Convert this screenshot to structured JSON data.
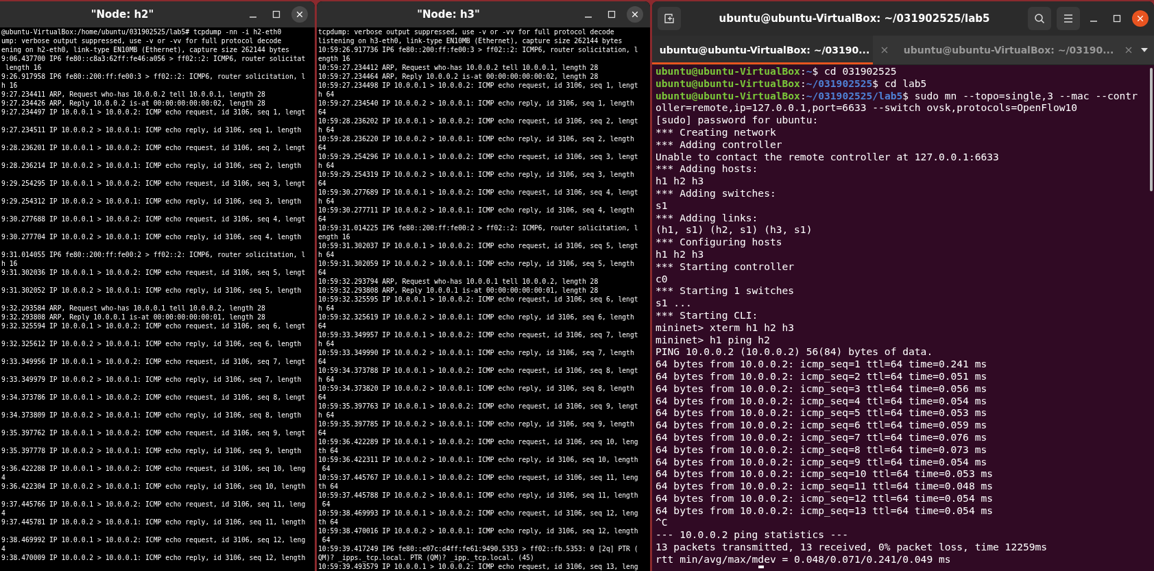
{
  "windows": [
    {
      "kind": "xterm",
      "title": "\"Node: h2\"",
      "lines": [
        {
          "kind": "text",
          "text": "@ubuntu-VirtualBox:/home/ubuntu/031902525/lab5# tcpdump -nn -i h2-eth0"
        },
        {
          "kind": "text",
          "text": "ump: verbose output suppressed, use -v or -vv for full protocol decode"
        },
        {
          "kind": "text",
          "text": "ening on h2-eth0, link-type EN10MB (Ethernet), capture size 262144 bytes"
        },
        {
          "kind": "text",
          "text": "9:06.437700 IP6 fe80::c8a3:62ff:fe46:a056 > ff02::2: ICMP6, router solicitat"
        },
        {
          "kind": "text",
          "text": " length 16"
        },
        {
          "kind": "text",
          "text": "9:26.917958 IP6 fe80::200:ff:fe00:3 > ff02::2: ICMP6, router solicitation, l"
        },
        {
          "kind": "text",
          "text": "h 16"
        },
        {
          "kind": "text",
          "text": "9:27.234411 ARP, Request who-has 10.0.0.2 tell 10.0.0.1, length 28"
        },
        {
          "kind": "text",
          "text": "9:27.234426 ARP, Reply 10.0.0.2 is-at 00:00:00:00:00:02, length 28"
        },
        {
          "kind": "text",
          "text": "9:27.234497 IP 10.0.0.1 > 10.0.0.2: ICMP echo request, id 3106, seq 1, lengt"
        },
        {
          "kind": "blank"
        },
        {
          "kind": "text",
          "text": "9:27.234511 IP 10.0.0.2 > 10.0.0.1: ICMP echo reply, id 3106, seq 1, length"
        },
        {
          "kind": "blank"
        },
        {
          "kind": "text",
          "text": "9:28.236201 IP 10.0.0.1 > 10.0.0.2: ICMP echo request, id 3106, seq 2, lengt"
        },
        {
          "kind": "blank"
        },
        {
          "kind": "text",
          "text": "9:28.236214 IP 10.0.0.2 > 10.0.0.1: ICMP echo reply, id 3106, seq 2, length"
        },
        {
          "kind": "blank"
        },
        {
          "kind": "text",
          "text": "9:29.254295 IP 10.0.0.1 > 10.0.0.2: ICMP echo request, id 3106, seq 3, lengt"
        },
        {
          "kind": "blank"
        },
        {
          "kind": "text",
          "text": "9:29.254312 IP 10.0.0.2 > 10.0.0.1: ICMP echo reply, id 3106, seq 3, length"
        },
        {
          "kind": "blank"
        },
        {
          "kind": "text",
          "text": "9:30.277688 IP 10.0.0.1 > 10.0.0.2: ICMP echo request, id 3106, seq 4, lengt"
        },
        {
          "kind": "blank"
        },
        {
          "kind": "text",
          "text": "9:30.277704 IP 10.0.0.2 > 10.0.0.1: ICMP echo reply, id 3106, seq 4, length"
        },
        {
          "kind": "blank"
        },
        {
          "kind": "text",
          "text": "9:31.014055 IP6 fe80::200:ff:fe00:2 > ff02::2: ICMP6, router solicitation, l"
        },
        {
          "kind": "text",
          "text": "h 16"
        },
        {
          "kind": "text",
          "text": "9:31.302036 IP 10.0.0.1 > 10.0.0.2: ICMP echo request, id 3106, seq 5, lengt"
        },
        {
          "kind": "blank"
        },
        {
          "kind": "text",
          "text": "9:31.302052 IP 10.0.0.2 > 10.0.0.1: ICMP echo reply, id 3106, seq 5, length"
        },
        {
          "kind": "blank"
        },
        {
          "kind": "text",
          "text": "9:32.293584 ARP, Request who-has 10.0.0.1 tell 10.0.0.2, length 28"
        },
        {
          "kind": "text",
          "text": "9:32.293808 ARP, Reply 10.0.0.1 is-at 00:00:00:00:00:01, length 28"
        },
        {
          "kind": "text",
          "text": "9:32.325594 IP 10.0.0.1 > 10.0.0.2: ICMP echo request, id 3106, seq 6, lengt"
        },
        {
          "kind": "blank"
        },
        {
          "kind": "text",
          "text": "9:32.325612 IP 10.0.0.2 > 10.0.0.1: ICMP echo reply, id 3106, seq 6, length"
        },
        {
          "kind": "blank"
        },
        {
          "kind": "text",
          "text": "9:33.349956 IP 10.0.0.1 > 10.0.0.2: ICMP echo request, id 3106, seq 7, lengt"
        },
        {
          "kind": "blank"
        },
        {
          "kind": "text",
          "text": "9:33.349979 IP 10.0.0.2 > 10.0.0.1: ICMP echo reply, id 3106, seq 7, length"
        },
        {
          "kind": "blank"
        },
        {
          "kind": "text",
          "text": "9:34.373786 IP 10.0.0.1 > 10.0.0.2: ICMP echo request, id 3106, seq 8, lengt"
        },
        {
          "kind": "blank"
        },
        {
          "kind": "text",
          "text": "9:34.373809 IP 10.0.0.2 > 10.0.0.1: ICMP echo reply, id 3106, seq 8, length"
        },
        {
          "kind": "blank"
        },
        {
          "kind": "text",
          "text": "9:35.397762 IP 10.0.0.1 > 10.0.0.2: ICMP echo request, id 3106, seq 9, lengt"
        },
        {
          "kind": "blank"
        },
        {
          "kind": "text",
          "text": "9:35.397778 IP 10.0.0.2 > 10.0.0.1: ICMP echo reply, id 3106, seq 9, length"
        },
        {
          "kind": "blank"
        },
        {
          "kind": "text",
          "text": "9:36.422288 IP 10.0.0.1 > 10.0.0.2: ICMP echo request, id 3106, seq 10, leng"
        },
        {
          "kind": "text",
          "text": "4"
        },
        {
          "kind": "text",
          "text": "9:36.422304 IP 10.0.0.2 > 10.0.0.1: ICMP echo reply, id 3106, seq 10, length"
        },
        {
          "kind": "blank"
        },
        {
          "kind": "text",
          "text": "9:37.445766 IP 10.0.0.1 > 10.0.0.2: ICMP echo request, id 3106, seq 11, leng"
        },
        {
          "kind": "text",
          "text": "4"
        },
        {
          "kind": "text",
          "text": "9:37.445781 IP 10.0.0.2 > 10.0.0.1: ICMP echo reply, id 3106, seq 11, length"
        },
        {
          "kind": "blank"
        },
        {
          "kind": "text",
          "text": "9:38.469992 IP 10.0.0.1 > 10.0.0.2: ICMP echo request, id 3106, seq 12, leng"
        },
        {
          "kind": "text",
          "text": "4"
        },
        {
          "kind": "text",
          "text": "9:38.470009 IP 10.0.0.2 > 10.0.0.1: ICMP echo reply, id 3106, seq 12, length"
        }
      ]
    },
    {
      "kind": "xterm",
      "title": "\"Node: h3\"",
      "lines": [
        {
          "kind": "text",
          "text": "tcpdump: verbose output suppressed, use -v or -vv for full protocol decode"
        },
        {
          "kind": "text",
          "text": "listening on h3-eth0, link-type EN10MB (Ethernet), capture size 262144 bytes"
        },
        {
          "kind": "text",
          "text": "10:59:26.917736 IP6 fe80::200:ff:fe00:3 > ff02::2: ICMP6, router solicitation, l"
        },
        {
          "kind": "text",
          "text": "ength 16"
        },
        {
          "kind": "text",
          "text": "10:59:27.234412 ARP, Request who-has 10.0.0.2 tell 10.0.0.1, length 28"
        },
        {
          "kind": "text",
          "text": "10:59:27.234464 ARP, Reply 10.0.0.2 is-at 00:00:00:00:00:02, length 28"
        },
        {
          "kind": "text",
          "text": "10:59:27.234498 IP 10.0.0.1 > 10.0.0.2: ICMP echo request, id 3106, seq 1, lengt"
        },
        {
          "kind": "text",
          "text": "h 64"
        },
        {
          "kind": "text",
          "text": "10:59:27.234540 IP 10.0.0.2 > 10.0.0.1: ICMP echo reply, id 3106, seq 1, length"
        },
        {
          "kind": "text",
          "text": "64"
        },
        {
          "kind": "text",
          "text": "10:59:28.236202 IP 10.0.0.1 > 10.0.0.2: ICMP echo request, id 3106, seq 2, lengt"
        },
        {
          "kind": "text",
          "text": "h 64"
        },
        {
          "kind": "text",
          "text": "10:59:28.236220 IP 10.0.0.2 > 10.0.0.1: ICMP echo reply, id 3106, seq 2, length"
        },
        {
          "kind": "text",
          "text": "64"
        },
        {
          "kind": "text",
          "text": "10:59:29.254296 IP 10.0.0.1 > 10.0.0.2: ICMP echo request, id 3106, seq 3, lengt"
        },
        {
          "kind": "text",
          "text": "h 64"
        },
        {
          "kind": "text",
          "text": "10:59:29.254319 IP 10.0.0.2 > 10.0.0.1: ICMP echo reply, id 3106, seq 3, length"
        },
        {
          "kind": "text",
          "text": "64"
        },
        {
          "kind": "text",
          "text": "10:59:30.277689 IP 10.0.0.1 > 10.0.0.2: ICMP echo request, id 3106, seq 4, lengt"
        },
        {
          "kind": "text",
          "text": "h 64"
        },
        {
          "kind": "text",
          "text": "10:59:30.277711 IP 10.0.0.2 > 10.0.0.1: ICMP echo reply, id 3106, seq 4, length"
        },
        {
          "kind": "text",
          "text": "64"
        },
        {
          "kind": "text",
          "text": "10:59:31.014225 IP6 fe80::200:ff:fe00:2 > ff02::2: ICMP6, router solicitation, l"
        },
        {
          "kind": "text",
          "text": "ength 16"
        },
        {
          "kind": "text",
          "text": "10:59:31.302037 IP 10.0.0.1 > 10.0.0.2: ICMP echo request, id 3106, seq 5, lengt"
        },
        {
          "kind": "text",
          "text": "h 64"
        },
        {
          "kind": "text",
          "text": "10:59:31.302059 IP 10.0.0.2 > 10.0.0.1: ICMP echo reply, id 3106, seq 5, length"
        },
        {
          "kind": "text",
          "text": "64"
        },
        {
          "kind": "text",
          "text": "10:59:32.293794 ARP, Request who-has 10.0.0.1 tell 10.0.0.2, length 28"
        },
        {
          "kind": "text",
          "text": "10:59:32.293808 ARP, Reply 10.0.0.1 is-at 00:00:00:00:00:01, length 28"
        },
        {
          "kind": "text",
          "text": "10:59:32.325595 IP 10.0.0.1 > 10.0.0.2: ICMP echo request, id 3106, seq 6, lengt"
        },
        {
          "kind": "text",
          "text": "h 64"
        },
        {
          "kind": "text",
          "text": "10:59:32.325619 IP 10.0.0.2 > 10.0.0.1: ICMP echo reply, id 3106, seq 6, length"
        },
        {
          "kind": "text",
          "text": "64"
        },
        {
          "kind": "text",
          "text": "10:59:33.349957 IP 10.0.0.1 > 10.0.0.2: ICMP echo request, id 3106, seq 7, lengt"
        },
        {
          "kind": "text",
          "text": "h 64"
        },
        {
          "kind": "text",
          "text": "10:59:33.349990 IP 10.0.0.2 > 10.0.0.1: ICMP echo reply, id 3106, seq 7, length"
        },
        {
          "kind": "text",
          "text": "64"
        },
        {
          "kind": "text",
          "text": "10:59:34.373788 IP 10.0.0.1 > 10.0.0.2: ICMP echo request, id 3106, seq 8, lengt"
        },
        {
          "kind": "text",
          "text": "h 64"
        },
        {
          "kind": "text",
          "text": "10:59:34.373820 IP 10.0.0.2 > 10.0.0.1: ICMP echo reply, id 3106, seq 8, length"
        },
        {
          "kind": "text",
          "text": "64"
        },
        {
          "kind": "text",
          "text": "10:59:35.397763 IP 10.0.0.1 > 10.0.0.2: ICMP echo request, id 3106, seq 9, lengt"
        },
        {
          "kind": "text",
          "text": "h 64"
        },
        {
          "kind": "text",
          "text": "10:59:35.397785 IP 10.0.0.2 > 10.0.0.1: ICMP echo reply, id 3106, seq 9, length"
        },
        {
          "kind": "text",
          "text": "64"
        },
        {
          "kind": "text",
          "text": "10:59:36.422289 IP 10.0.0.1 > 10.0.0.2: ICMP echo request, id 3106, seq 10, leng"
        },
        {
          "kind": "text",
          "text": "th 64"
        },
        {
          "kind": "text",
          "text": "10:59:36.422311 IP 10.0.0.2 > 10.0.0.1: ICMP echo reply, id 3106, seq 10, length"
        },
        {
          "kind": "text",
          "text": " 64"
        },
        {
          "kind": "text",
          "text": "10:59:37.445767 IP 10.0.0.1 > 10.0.0.2: ICMP echo request, id 3106, seq 11, leng"
        },
        {
          "kind": "text",
          "text": "th 64"
        },
        {
          "kind": "text",
          "text": "10:59:37.445788 IP 10.0.0.2 > 10.0.0.1: ICMP echo reply, id 3106, seq 11, length"
        },
        {
          "kind": "text",
          "text": " 64"
        },
        {
          "kind": "text",
          "text": "10:59:38.469993 IP 10.0.0.1 > 10.0.0.2: ICMP echo request, id 3106, seq 12, leng"
        },
        {
          "kind": "text",
          "text": "th 64"
        },
        {
          "kind": "text",
          "text": "10:59:38.470016 IP 10.0.0.2 > 10.0.0.1: ICMP echo reply, id 3106, seq 12, length"
        },
        {
          "kind": "text",
          "text": " 64"
        },
        {
          "kind": "text",
          "text": "10:59:39.417249 IP6 fe80::e07c:d4ff:fe61:9490.5353 > ff02::fb.5353: 0 [2q] PTR ("
        },
        {
          "kind": "text",
          "text": "QM)? _ipps._tcp.local. PTR (QM)? _ipp._tcp.local. (45)"
        },
        {
          "kind": "text",
          "text": "10:59:39.493579 IP 10.0.0.1 > 10.0.0.2: ICMP echo request, id 3106, seq 13, leng"
        }
      ]
    },
    {
      "kind": "terminal",
      "title": "ubuntu@ubuntu-VirtualBox: ~/031902525/lab5",
      "tabs": [
        {
          "label": "ubuntu@ubuntu-VirtualBox: ~/03190...",
          "selected": true
        },
        {
          "label": "ubuntu@ubuntu-VirtualBox: ~/03190...",
          "selected": false
        }
      ],
      "lines": [
        {
          "kind": "prompt",
          "user": "ubuntu@ubuntu-VirtualBox",
          "separator": ":",
          "path": "~",
          "command": "$ cd 031902525"
        },
        {
          "kind": "prompt",
          "user": "ubuntu@ubuntu-VirtualBox",
          "separator": ":",
          "path": "~/031902525",
          "command": "$ cd lab5"
        },
        {
          "kind": "prompt",
          "user": "ubuntu@ubuntu-VirtualBox",
          "separator": ":",
          "path": "~/031902525/lab5",
          "command": "$ sudo mn --topo=single,3 --mac --contr"
        },
        {
          "kind": "output",
          "text": "oller=remote,ip=127.0.0.1,port=6633 --switch ovsk,protocols=OpenFlow10"
        },
        {
          "kind": "output",
          "text": "[sudo] password for ubuntu:"
        },
        {
          "kind": "output",
          "text": "*** Creating network"
        },
        {
          "kind": "output",
          "text": "*** Adding controller"
        },
        {
          "kind": "output",
          "text": "Unable to contact the remote controller at 127.0.0.1:6633"
        },
        {
          "kind": "output",
          "text": "*** Adding hosts:"
        },
        {
          "kind": "output",
          "text": "h1 h2 h3"
        },
        {
          "kind": "output",
          "text": "*** Adding switches:"
        },
        {
          "kind": "output",
          "text": "s1"
        },
        {
          "kind": "output",
          "text": "*** Adding links:"
        },
        {
          "kind": "output",
          "text": "(h1, s1) (h2, s1) (h3, s1)"
        },
        {
          "kind": "output",
          "text": "*** Configuring hosts"
        },
        {
          "kind": "output",
          "text": "h1 h2 h3"
        },
        {
          "kind": "output",
          "text": "*** Starting controller"
        },
        {
          "kind": "output",
          "text": "c0"
        },
        {
          "kind": "output",
          "text": "*** Starting 1 switches"
        },
        {
          "kind": "output",
          "text": "s1 ..."
        },
        {
          "kind": "output",
          "text": "*** Starting CLI:"
        },
        {
          "kind": "output",
          "text": "mininet> xterm h1 h2 h3"
        },
        {
          "kind": "output",
          "text": "mininet> h1 ping h2"
        },
        {
          "kind": "output",
          "text": "PING 10.0.0.2 (10.0.0.2) 56(84) bytes of data."
        },
        {
          "kind": "output",
          "text": "64 bytes from 10.0.0.2: icmp_seq=1 ttl=64 time=0.241 ms"
        },
        {
          "kind": "output",
          "text": "64 bytes from 10.0.0.2: icmp_seq=2 ttl=64 time=0.051 ms"
        },
        {
          "kind": "output",
          "text": "64 bytes from 10.0.0.2: icmp_seq=3 ttl=64 time=0.056 ms"
        },
        {
          "kind": "output",
          "text": "64 bytes from 10.0.0.2: icmp_seq=4 ttl=64 time=0.054 ms"
        },
        {
          "kind": "output",
          "text": "64 bytes from 10.0.0.2: icmp_seq=5 ttl=64 time=0.053 ms"
        },
        {
          "kind": "output",
          "text": "64 bytes from 10.0.0.2: icmp_seq=6 ttl=64 time=0.059 ms"
        },
        {
          "kind": "output",
          "text": "64 bytes from 10.0.0.2: icmp_seq=7 ttl=64 time=0.076 ms"
        },
        {
          "kind": "output",
          "text": "64 bytes from 10.0.0.2: icmp_seq=8 ttl=64 time=0.073 ms"
        },
        {
          "kind": "output",
          "text": "64 bytes from 10.0.0.2: icmp_seq=9 ttl=64 time=0.054 ms"
        },
        {
          "kind": "output",
          "text": "64 bytes from 10.0.0.2: icmp_seq=10 ttl=64 time=0.053 ms"
        },
        {
          "kind": "output",
          "text": "64 bytes from 10.0.0.2: icmp_seq=11 ttl=64 time=0.048 ms"
        },
        {
          "kind": "output",
          "text": "64 bytes from 10.0.0.2: icmp_seq=12 ttl=64 time=0.054 ms"
        },
        {
          "kind": "output",
          "text": "64 bytes from 10.0.0.2: icmp_seq=13 ttl=64 time=0.054 ms"
        },
        {
          "kind": "output",
          "text": "^C"
        },
        {
          "kind": "output",
          "text": "--- 10.0.0.2 ping statistics ---"
        },
        {
          "kind": "output",
          "text": "13 packets transmitted, 13 received, 0% packet loss, time 12259ms"
        },
        {
          "kind": "output",
          "text": "rtt min/avg/max/mdev = 0.048/0.071/0.241/0.049 ms"
        }
      ]
    }
  ]
}
